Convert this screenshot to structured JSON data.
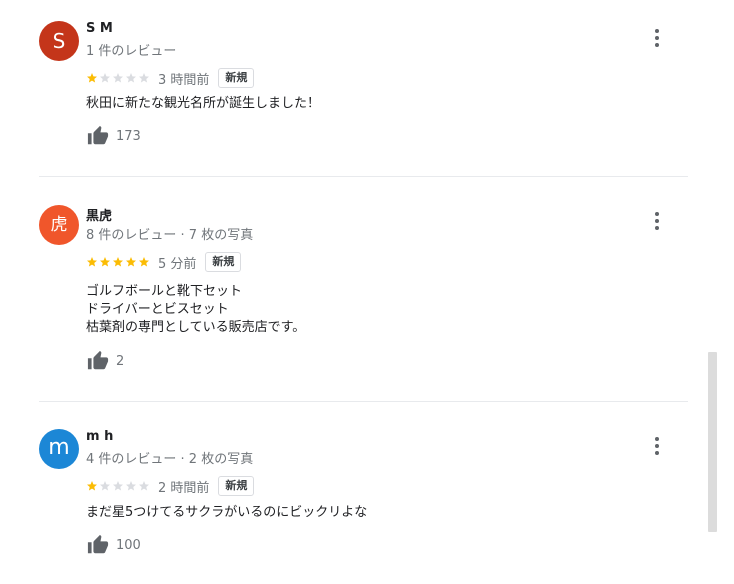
{
  "colors": {
    "star_filled": "#fbbc04",
    "star_empty": "#dadce0",
    "avatar_sm": "#c4351a",
    "avatar_kuroto": "#f0562b",
    "avatar_mh": "#1c87d6"
  },
  "reviews": [
    {
      "avatar_letter": "S",
      "name": "S M",
      "meta": "1 件のレビュー",
      "rating": 1,
      "time": "3 時間前",
      "badge": "新規",
      "text_lines": [
        "秋田に新たな観光名所が誕生しました！"
      ],
      "likes": "173"
    },
    {
      "avatar_letter": "虎",
      "name": "黒虎",
      "meta": "8 件のレビュー · 7 枚の写真",
      "rating": 5,
      "time": "5 分前",
      "badge": "新規",
      "text_lines": [
        "ゴルフボールと靴下セット",
        "ドライバーとビスセット",
        "枯葉剤の専門としている販売店です。"
      ],
      "likes": "2"
    },
    {
      "avatar_letter": "m",
      "name": "m h",
      "meta": "4 件のレビュー · 2 枚の写真",
      "rating": 1,
      "time": "2 時間前",
      "badge": "新規",
      "text_lines": [
        "まだ星5つけてるサクラがいるのにビックリよな"
      ],
      "likes": "100"
    }
  ],
  "icons": {
    "like": "thumbs-up-icon",
    "more": "more-vertical-icon",
    "star": "star-icon"
  }
}
